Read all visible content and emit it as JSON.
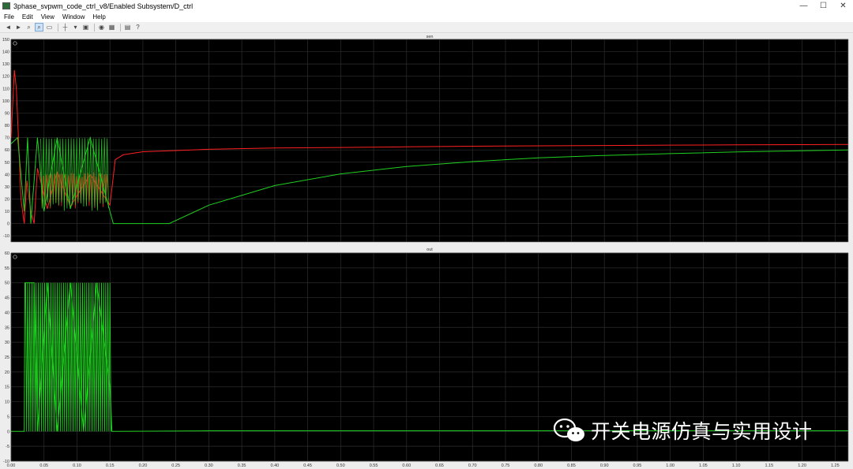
{
  "window": {
    "title": "3phase_svpwm_code_ctrl_v8/Enabled Subsystem/D_ctrl"
  },
  "window_buttons": {
    "minimize": "—",
    "maximize": "☐",
    "close": "✕"
  },
  "menu": [
    "File",
    "Edit",
    "View",
    "Window",
    "Help"
  ],
  "toolbar": [
    {
      "name": "back-icon",
      "glyph": "◄"
    },
    {
      "name": "forward-icon",
      "glyph": "►"
    },
    {
      "name": "zoom-icon",
      "glyph": "⌕"
    },
    {
      "name": "zoom-x-icon",
      "glyph": "⌕",
      "active": true
    },
    {
      "name": "autoscale-icon",
      "glyph": "▭"
    },
    {
      "name": "sep"
    },
    {
      "name": "cursor-icon",
      "glyph": "┼"
    },
    {
      "name": "dropdown-icon",
      "glyph": "▾"
    },
    {
      "name": "display-icon",
      "glyph": "▣"
    },
    {
      "name": "sep"
    },
    {
      "name": "highlight-icon",
      "glyph": "◉"
    },
    {
      "name": "signal-select-icon",
      "glyph": "▦"
    },
    {
      "name": "sep"
    },
    {
      "name": "properties-icon",
      "glyph": "▤"
    },
    {
      "name": "help-icon",
      "glyph": "?"
    }
  ],
  "scope": {
    "background": "#000000",
    "grid": "#2e2e2e"
  },
  "chart_data": [
    {
      "type": "line",
      "title": "sen",
      "xlim": [
        0,
        1.27
      ],
      "ylim": [
        -15,
        150
      ],
      "x_ticks": [
        "0.00",
        "0.05",
        "0.10",
        "0.15",
        "0.20",
        "0.25",
        "0.30",
        "0.35",
        "0.40",
        "0.45",
        "0.50",
        "0.55",
        "0.60",
        "0.65",
        "0.70",
        "0.75",
        "0.80",
        "0.85",
        "0.90",
        "0.95",
        "1.00",
        "1.05",
        "1.10",
        "1.15",
        "1.20",
        "1.25"
      ],
      "y_ticks": [
        "150",
        "140",
        "130",
        "120",
        "110",
        "100",
        "90",
        "80",
        "70",
        "60",
        "50",
        "40",
        "30",
        "20",
        "10",
        "0",
        "-10"
      ],
      "series": [
        {
          "color": "#ff2020",
          "x": [
            0.0,
            0.005,
            0.008,
            0.012,
            0.015,
            0.02,
            0.024,
            0.03,
            0.035,
            0.04,
            0.055,
            0.07,
            0.09,
            0.12,
            0.15,
            0.158,
            0.17,
            0.2,
            0.25,
            0.3,
            0.4,
            0.5,
            0.6,
            0.7,
            0.8,
            0.9,
            1.0,
            1.1,
            1.2,
            1.27
          ],
          "y": [
            70,
            125,
            110,
            60,
            20,
            0,
            35,
            10,
            0,
            45,
            12,
            42,
            14,
            40,
            15,
            52,
            56,
            58.5,
            59.5,
            60.5,
            61.5,
            62,
            62.5,
            63,
            63.3,
            63.6,
            63.9,
            64.1,
            64.3,
            64.5
          ]
        },
        {
          "color": "#20d020",
          "x": [
            0.0,
            0.01,
            0.02,
            0.025,
            0.03,
            0.04,
            0.05,
            0.07,
            0.09,
            0.12,
            0.15,
            0.155,
            0.2,
            0.24,
            0.3,
            0.4,
            0.5,
            0.6,
            0.7,
            0.8,
            0.9,
            1.0,
            1.1,
            1.2,
            1.27
          ],
          "y": [
            65,
            70,
            10,
            70,
            0,
            70,
            10,
            70,
            12,
            70,
            10,
            0,
            0,
            0,
            15,
            31,
            40.5,
            46.5,
            50.5,
            53.5,
            55.5,
            57,
            58.3,
            59.3,
            60
          ]
        }
      ]
    },
    {
      "type": "line",
      "title": "out",
      "xlim": [
        0,
        1.27
      ],
      "ylim": [
        -10,
        60
      ],
      "x_ticks": [
        "0.00",
        "0.05",
        "0.10",
        "0.15",
        "0.20",
        "0.25",
        "0.30",
        "0.35",
        "0.40",
        "0.45",
        "0.50",
        "0.55",
        "0.60",
        "0.65",
        "0.70",
        "0.75",
        "0.80",
        "0.85",
        "0.90",
        "0.95",
        "1.00",
        "1.05",
        "1.10",
        "1.15",
        "1.20",
        "1.25"
      ],
      "y_ticks": [
        "60",
        "55",
        "50",
        "45",
        "40",
        "35",
        "30",
        "25",
        "20",
        "15",
        "10",
        "5",
        "0",
        "-5",
        "-10"
      ],
      "series": [
        {
          "color": "#20d020",
          "x": [
            0.0,
            0.02,
            0.021,
            0.035,
            0.04,
            0.055,
            0.07,
            0.09,
            0.11,
            0.13,
            0.15,
            0.153,
            0.16,
            0.3,
            0.6,
            0.9,
            1.27
          ],
          "y": [
            0,
            0,
            50,
            50,
            0,
            50,
            0,
            50,
            0,
            50,
            15,
            0,
            0,
            0.2,
            0.2,
            0.2,
            0.2
          ]
        }
      ]
    }
  ],
  "watermark": {
    "text": "开关电源仿真与实用设计",
    "icon": "wechat-icon"
  }
}
